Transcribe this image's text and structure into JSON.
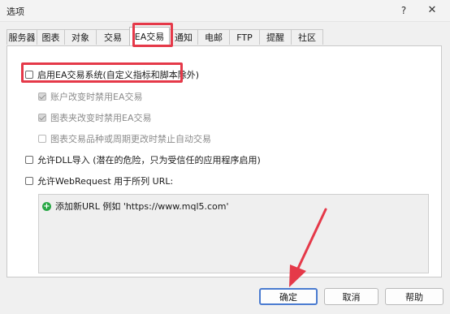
{
  "window": {
    "title": "选项",
    "help_glyph": "?",
    "close_glyph": "✕"
  },
  "tabs": [
    {
      "label": "服务器"
    },
    {
      "label": "图表"
    },
    {
      "label": "对象"
    },
    {
      "label": "交易"
    },
    {
      "label": "EA交易",
      "active": true
    },
    {
      "label": "通知"
    },
    {
      "label": "电邮"
    },
    {
      "label": "FTP"
    },
    {
      "label": "提醒"
    },
    {
      "label": "社区"
    }
  ],
  "options": {
    "enable_ea": {
      "label": "启用EA交易系统(自定义指标和脚本除外)",
      "checked": false
    },
    "disable_on_account_change": {
      "label": "账户改变时禁用EA交易",
      "checked": true,
      "disabled": true
    },
    "disable_on_profile_change": {
      "label": "图表夹改变时禁用EA交易",
      "checked": true,
      "disabled": true
    },
    "disable_on_symbol_change": {
      "label": "图表交易品种或周期更改时禁止自动交易",
      "checked": false,
      "disabled": true
    },
    "allow_dll": {
      "label": "允许DLL导入 (潜在的危险，只为受信任的应用程序启用)",
      "checked": false
    },
    "allow_webrequest": {
      "label": "允许WebRequest 用于所列 URL:",
      "checked": false
    }
  },
  "url_list": {
    "add_item": "添加新URL 例如 'https://www.mql5.com'"
  },
  "buttons": {
    "ok": "确定",
    "cancel": "取消",
    "help": "帮助"
  },
  "colors": {
    "annotation": "#e53949",
    "primary_border": "#4a7bd0",
    "add_icon": "#28a745"
  }
}
